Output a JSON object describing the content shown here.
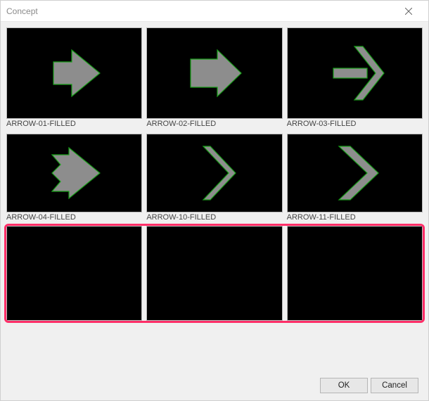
{
  "window": {
    "title": "Concept"
  },
  "thumbs": {
    "r1c1": {
      "label": "ARROW-01-FILLED"
    },
    "r1c2": {
      "label": "ARROW-02-FILLED"
    },
    "r1c3": {
      "label": "ARROW-03-FILLED"
    },
    "r2c1": {
      "label": "ARROW-04-FILLED"
    },
    "r2c2": {
      "label": "ARROW-10-FILLED"
    },
    "r2c3": {
      "label": "ARROW-11-FILLED"
    }
  },
  "buttons": {
    "ok": "OK",
    "cancel": "Cancel"
  },
  "colors": {
    "highlight": "#ff2e68",
    "shape_fill": "#8d8d8d",
    "shape_stroke": "#18a018",
    "thumb_bg": "#000000"
  }
}
